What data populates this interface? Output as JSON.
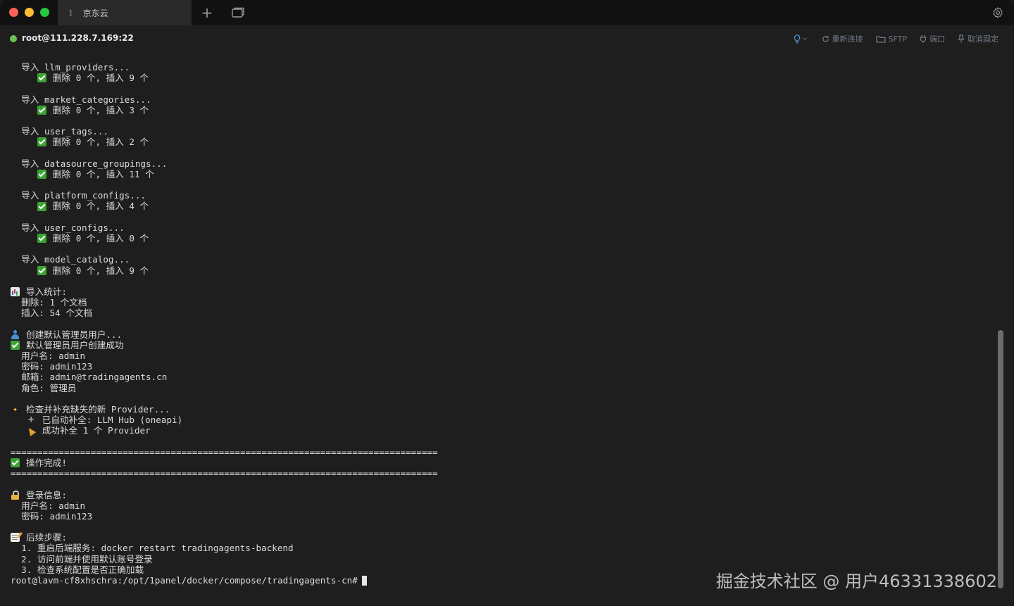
{
  "titlebar": {
    "tab_number": "1",
    "tab_title": "京东云"
  },
  "connection": {
    "host": "root@111.228.7.169:22",
    "status_color": "#6ec453",
    "actions": {
      "reconnect": "重新连接",
      "sftp": "SFTP",
      "port": "端口",
      "unpin": "取消固定"
    }
  },
  "terminal": {
    "lines": [
      {
        "icon": "",
        "indent": "  ",
        "text": "导入 llm_providers..."
      },
      {
        "icon": "check",
        "indent": "     ",
        "text": "删除 0 个, 插入 9 个"
      },
      {
        "icon": "",
        "indent": "",
        "text": ""
      },
      {
        "icon": "",
        "indent": "  ",
        "text": "导入 market_categories..."
      },
      {
        "icon": "check",
        "indent": "     ",
        "text": "删除 0 个, 插入 3 个"
      },
      {
        "icon": "",
        "indent": "",
        "text": ""
      },
      {
        "icon": "",
        "indent": "  ",
        "text": "导入 user_tags..."
      },
      {
        "icon": "check",
        "indent": "     ",
        "text": "删除 0 个, 插入 2 个"
      },
      {
        "icon": "",
        "indent": "",
        "text": ""
      },
      {
        "icon": "",
        "indent": "  ",
        "text": "导入 datasource_groupings..."
      },
      {
        "icon": "check",
        "indent": "     ",
        "text": "删除 0 个, 插入 11 个"
      },
      {
        "icon": "",
        "indent": "",
        "text": ""
      },
      {
        "icon": "",
        "indent": "  ",
        "text": "导入 platform_configs..."
      },
      {
        "icon": "check",
        "indent": "     ",
        "text": "删除 0 个, 插入 4 个"
      },
      {
        "icon": "",
        "indent": "",
        "text": ""
      },
      {
        "icon": "",
        "indent": "  ",
        "text": "导入 user_configs..."
      },
      {
        "icon": "check",
        "indent": "     ",
        "text": "删除 0 个, 插入 0 个"
      },
      {
        "icon": "",
        "indent": "",
        "text": ""
      },
      {
        "icon": "",
        "indent": "  ",
        "text": "导入 model_catalog..."
      },
      {
        "icon": "check",
        "indent": "     ",
        "text": "删除 0 个, 插入 9 个"
      },
      {
        "icon": "",
        "indent": "",
        "text": ""
      },
      {
        "icon": "chart",
        "indent": "",
        "text": "导入统计:"
      },
      {
        "icon": "",
        "indent": "  ",
        "text": "删除: 1 个文档"
      },
      {
        "icon": "",
        "indent": "  ",
        "text": "插入: 54 个文档"
      },
      {
        "icon": "",
        "indent": "",
        "text": ""
      },
      {
        "icon": "user",
        "indent": "",
        "text": "创建默认管理员用户..."
      },
      {
        "icon": "check",
        "indent": "",
        "text": "默认管理员用户创建成功"
      },
      {
        "icon": "",
        "indent": "  ",
        "text": "用户名: admin"
      },
      {
        "icon": "",
        "indent": "  ",
        "text": "密码: admin123"
      },
      {
        "icon": "",
        "indent": "  ",
        "text": "邮箱: admin@tradingagents.cn"
      },
      {
        "icon": "",
        "indent": "  ",
        "text": "角色: 管理员"
      },
      {
        "icon": "",
        "indent": "",
        "text": ""
      },
      {
        "icon": "sparkle",
        "indent": "",
        "text": "检查并补充缺失的新 Provider..."
      },
      {
        "icon": "plus",
        "indent": "   ",
        "text": "已自动补全: LLM Hub (oneapi)"
      },
      {
        "icon": "party",
        "indent": "   ",
        "text": "成功补全 1 个 Provider"
      },
      {
        "icon": "",
        "indent": "",
        "text": ""
      },
      {
        "icon": "",
        "indent": "",
        "text": "================================================================================"
      },
      {
        "icon": "check",
        "indent": "",
        "text": "操作完成!"
      },
      {
        "icon": "",
        "indent": "",
        "text": "================================================================================"
      },
      {
        "icon": "",
        "indent": "",
        "text": ""
      },
      {
        "icon": "lock",
        "indent": "",
        "text": "登录信息:"
      },
      {
        "icon": "",
        "indent": "  ",
        "text": "用户名: admin"
      },
      {
        "icon": "",
        "indent": "  ",
        "text": "密码: admin123"
      },
      {
        "icon": "",
        "indent": "",
        "text": ""
      },
      {
        "icon": "memo",
        "indent": "",
        "text": "后续步骤:"
      },
      {
        "icon": "",
        "indent": "  ",
        "text": "1. 重启后端服务: docker restart tradingagents-backend"
      },
      {
        "icon": "",
        "indent": "  ",
        "text": "2. 访问前端并使用默认账号登录"
      },
      {
        "icon": "",
        "indent": "  ",
        "text": "3. 检查系统配置是否正确加载"
      },
      {
        "icon": "",
        "indent": "",
        "text": "root@lavm-cf8xhschra:/opt/1panel/docker/compose/tradingagents-cn#",
        "prompt": true
      }
    ]
  },
  "scroll": {
    "position_fraction": 0.9
  },
  "watermark": "掘金技术社区 @ 用户46331338602"
}
